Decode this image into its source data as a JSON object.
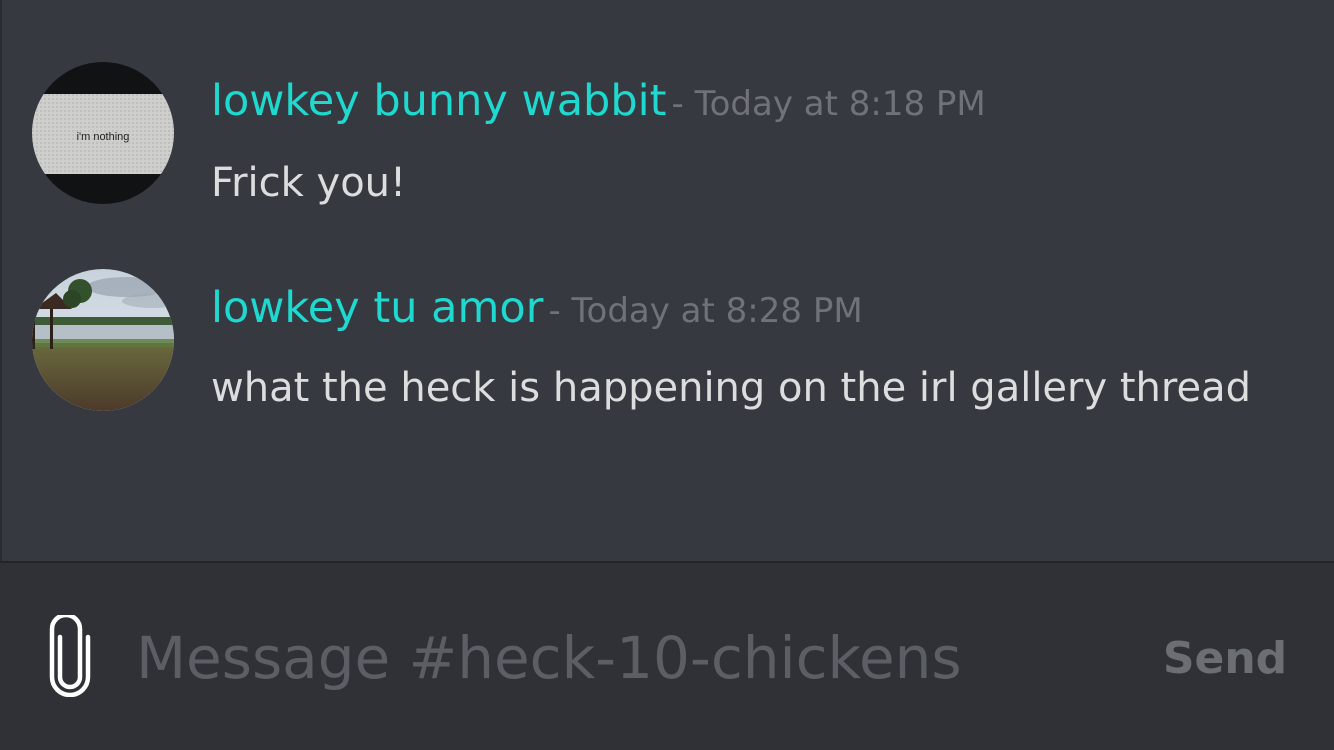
{
  "channel": "heck-10-chickens",
  "colors": {
    "background": "#36393f",
    "composer_background": "#2f3136",
    "username": "#1ed9cf",
    "timestamp": "#6f7277",
    "message_text": "#dcddde",
    "placeholder": "#5b5e64",
    "send": "#6b6e73"
  },
  "messages": [
    {
      "username": "lowkey bunny wabbit",
      "timestamp": "- Today at 8:18 PM",
      "content": "Frick you!",
      "avatar": {
        "icon": "avatar-image",
        "caption": "i'm nothing"
      }
    },
    {
      "username": "lowkey tu amor",
      "timestamp": "- Today at 8:28 PM",
      "content": "what the heck is happening on the irl gallery thread",
      "avatar": {
        "icon": "avatar-image"
      }
    }
  ],
  "composer": {
    "attach_icon": "paperclip-icon",
    "placeholder": "Message #heck-10-chickens",
    "value": "",
    "send_label": "Send"
  }
}
